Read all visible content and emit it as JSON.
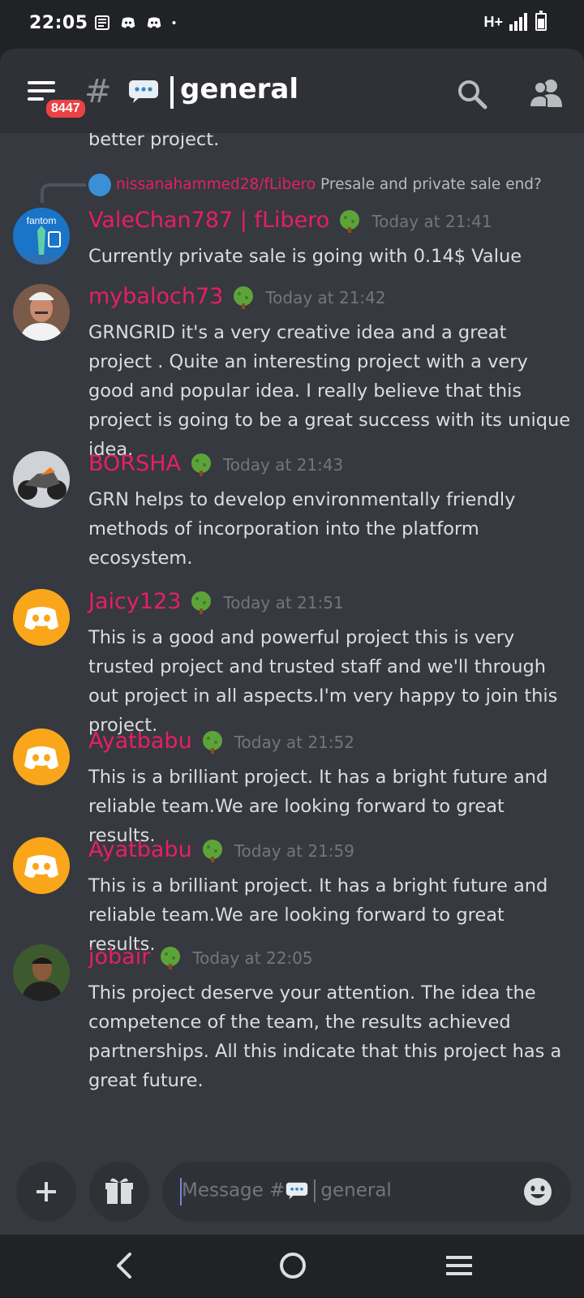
{
  "status_bar": {
    "time": "22:05",
    "network": "H+"
  },
  "header": {
    "badge_count": "8447",
    "channel_name": "general"
  },
  "partial_message": {
    "text": "better project."
  },
  "messages": [
    {
      "author": "ValeChan787 | fLibero",
      "time": "Today at 21:41",
      "text": "Currently private sale is going with 0.14$ Value",
      "reply": {
        "author": "nissanahammed28/fLibero",
        "text": "Presale and private sale end?"
      }
    },
    {
      "author": "mybaloch73",
      "time": "Today at 21:42",
      "text": "GRNGRID it's a very creative idea and a great project . Quite an interesting project with a very good and popular idea. I really believe that this project is going to be a great success with its unique idea."
    },
    {
      "author": "BORSHA",
      "time": "Today at 21:43",
      "text": "GRN helps to develop environmentally friendly methods of incorporation into the platform ecosystem."
    },
    {
      "author": "Jaicy123",
      "time": "Today at 21:51",
      "text": "This is a good and powerful project this is very trusted project and trusted staff and we'll through out project in all aspects.I'm very happy to join this project."
    },
    {
      "author": "Ayatbabu",
      "time": "Today at 21:52",
      "text": "This is a brilliant project. It has a bright future and reliable team.We are looking forward to great results."
    },
    {
      "author": "Ayatbabu",
      "time": "Today at 21:59",
      "text": "This is a brilliant project. It has a bright future and reliable team.We are looking forward to great results."
    },
    {
      "author": "jobair",
      "time": "Today at 22:05",
      "text": "This project deserve your attention. The idea the competence of the team, the results achieved partnerships. All this indicate that this project has a great future."
    }
  ],
  "composer": {
    "placeholder_prefix": "Message #",
    "placeholder_channel": "general"
  },
  "colors": {
    "author": "#e91e63",
    "background": "#36393f",
    "discord_orange": "#faa61a",
    "badge": "#ed4245"
  },
  "icons": [
    "hamburger-icon",
    "hash-icon",
    "speech-bubble-icon",
    "search-icon",
    "members-icon",
    "plus-icon",
    "gift-icon",
    "emoji-icon",
    "back-icon",
    "home-icon",
    "recents-icon",
    "tree-badge-icon"
  ]
}
